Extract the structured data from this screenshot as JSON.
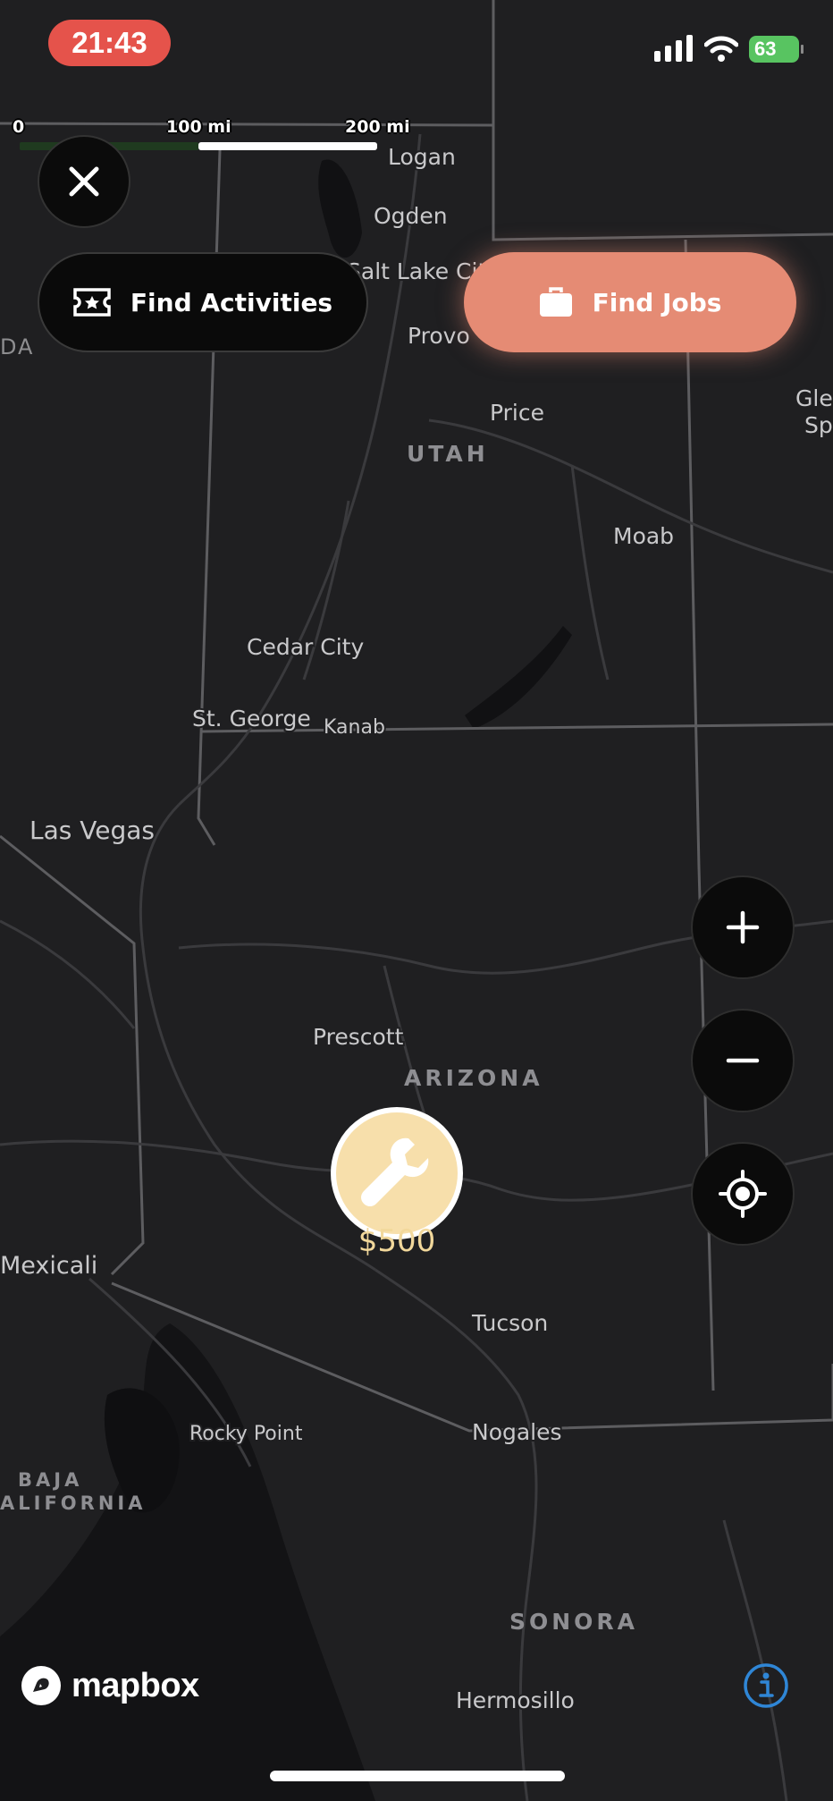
{
  "status_bar": {
    "time": "21:43",
    "battery": "63"
  },
  "scale": {
    "labels": [
      "0",
      "100 mi",
      "200 mi"
    ]
  },
  "buttons": {
    "find_activities": "Find Activities",
    "find_jobs": "Find Jobs"
  },
  "map": {
    "cities": [
      "Logan",
      "Ogden",
      "Salt Lake City",
      "Provo",
      "Price",
      "Moab",
      "Gle",
      "Sp",
      "Cedar City",
      "St. George",
      "Kanab",
      "Las Vegas",
      "Prescott",
      "Mexicali",
      "Tucson",
      "Rocky Point",
      "Nogales",
      "Hermosillo",
      "DA"
    ],
    "regions": [
      "UTAH",
      "ARIZONA",
      "BAJA",
      "ALIFORNIA",
      "SONORA"
    ]
  },
  "job_marker": {
    "price": "$500",
    "icon": "wrench-icon"
  },
  "attribution": {
    "logo": "mapbox"
  },
  "colors": {
    "accent": "#e58b74",
    "marker": "#f7dfab",
    "map_bg": "#1f1f21",
    "status_pill": "#e5534b"
  }
}
